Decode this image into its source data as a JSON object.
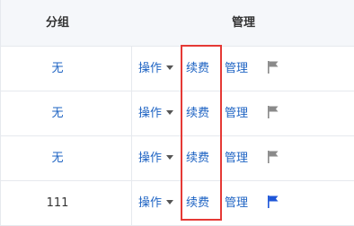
{
  "header": {
    "group_label": "分组",
    "manage_label": "管理"
  },
  "rows": [
    {
      "group": "无",
      "group_style": "link",
      "op_label": "操作",
      "renew_label": "续费",
      "manage_label": "管理",
      "flag_color": "#8a8a8a",
      "flag_icon": "flag-icon"
    },
    {
      "group": "无",
      "group_style": "link",
      "op_label": "操作",
      "renew_label": "续费",
      "manage_label": "管理",
      "flag_color": "#8a8a8a",
      "flag_icon": "flag-icon"
    },
    {
      "group": "无",
      "group_style": "link",
      "op_label": "操作",
      "renew_label": "续费",
      "manage_label": "管理",
      "flag_color": "#8a8a8a",
      "flag_icon": "flag-icon"
    },
    {
      "group": "111",
      "group_style": "plain",
      "op_label": "操作",
      "renew_label": "续费",
      "manage_label": "管理",
      "flag_color": "#1e56d8",
      "flag_icon": "flag-icon"
    }
  ],
  "colors": {
    "link": "#1e63c3",
    "highlight_border": "#e53935",
    "header_bg": "#f5f7fa"
  }
}
